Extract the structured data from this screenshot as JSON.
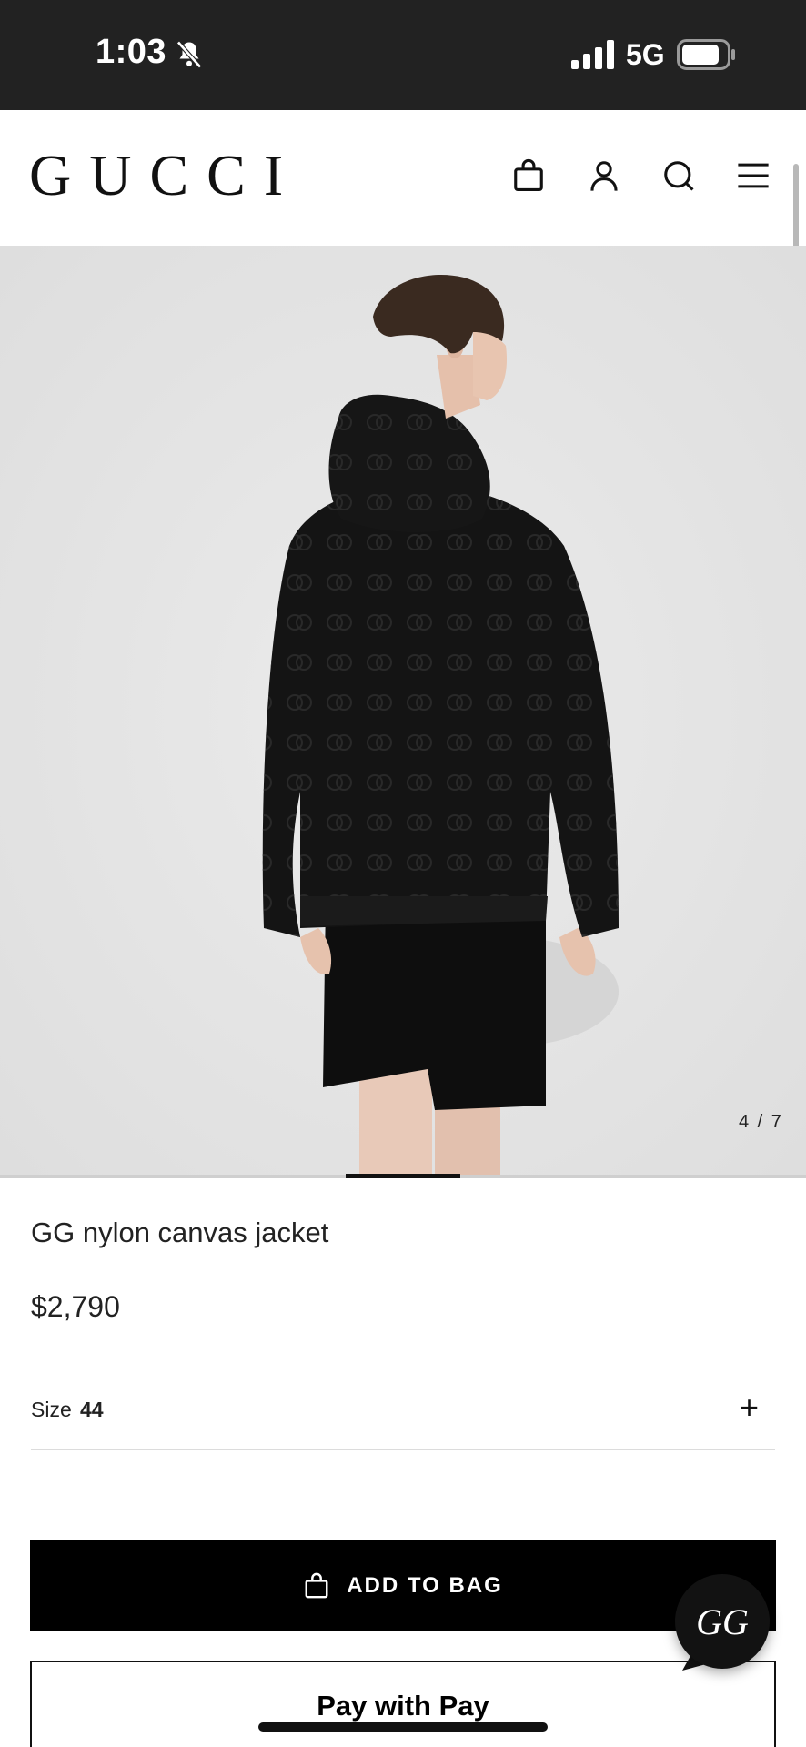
{
  "status_bar": {
    "time": "1:03",
    "network": "5G",
    "icons": [
      "bell-slash-icon",
      "signal-icon",
      "battery-icon"
    ]
  },
  "header": {
    "logo": "GUCCI",
    "icons": [
      "shopping-bag-icon",
      "account-icon",
      "search-icon",
      "menu-icon"
    ]
  },
  "gallery": {
    "counter": "4 / 7",
    "current": 4,
    "total": 7
  },
  "product": {
    "title": "GG nylon canvas jacket",
    "price": "$2,790"
  },
  "size_selector": {
    "label": "Size",
    "value": "44",
    "expand_icon": "+"
  },
  "actions": {
    "add_to_bag_label": "ADD TO BAG",
    "apple_pay_label": "Pay with  Pay",
    "apple_pay_text": "Pay with  Pay"
  },
  "chat": {
    "label": "GG"
  },
  "colors": {
    "status_bar_bg": "#222222",
    "button_bg": "#000000",
    "image_bg": "#e4e4e4"
  }
}
